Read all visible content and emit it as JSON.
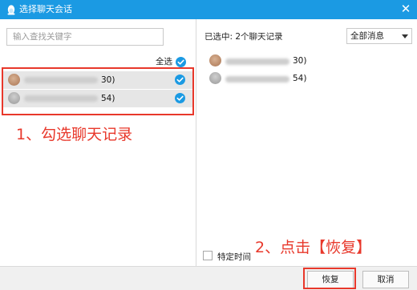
{
  "window": {
    "title": "选择聊天会话",
    "close_icon": "close-icon"
  },
  "left": {
    "search_placeholder": "输入查找关键字",
    "select_all_label": "全选",
    "items": [
      {
        "suffix": "30)",
        "avatar": "avatar-photo",
        "checked": true
      },
      {
        "suffix": "54)",
        "avatar": "avatar-default",
        "checked": true
      }
    ]
  },
  "right": {
    "selected_info": "已选中: 2个聊天记录",
    "filter": {
      "selected": "全部消息"
    },
    "items": [
      {
        "suffix": "30)"
      },
      {
        "suffix": "54)"
      }
    ],
    "specific_time_label": "特定时间"
  },
  "footer": {
    "restore_label": "恢复",
    "cancel_label": "取消"
  },
  "annotations": {
    "step1": "1、勾选聊天记录",
    "step2": "2、点击【恢复】"
  },
  "colors": {
    "accent": "#1b9ae3",
    "annotation": "#e8382b"
  }
}
